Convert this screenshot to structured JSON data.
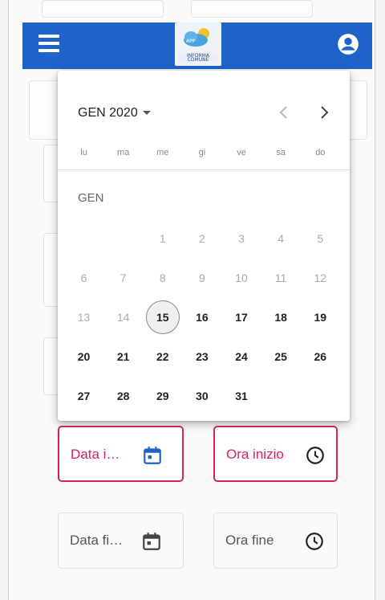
{
  "header": {
    "logo_text": "INFORMA COMUNE",
    "menu_icon": "menu-icon",
    "account_icon": "account-circle-icon",
    "color": "#1e64c8"
  },
  "calendar": {
    "month_year": "GEN 2020",
    "month_label": "GEN",
    "prev_icon": "chevron-left-icon",
    "next_icon": "chevron-right-icon",
    "weekdays": [
      "lu",
      "ma",
      "me",
      "gi",
      "ve",
      "sa",
      "do"
    ],
    "weeks": [
      [
        {
          "day": "",
          "state": "empty"
        },
        {
          "day": "",
          "state": "empty"
        },
        {
          "day": "1",
          "state": "disabled"
        },
        {
          "day": "2",
          "state": "disabled"
        },
        {
          "day": "3",
          "state": "disabled"
        },
        {
          "day": "4",
          "state": "disabled"
        },
        {
          "day": "5",
          "state": "disabled"
        }
      ],
      [
        {
          "day": "6",
          "state": "disabled"
        },
        {
          "day": "7",
          "state": "disabled"
        },
        {
          "day": "8",
          "state": "disabled"
        },
        {
          "day": "9",
          "state": "disabled"
        },
        {
          "day": "10",
          "state": "disabled"
        },
        {
          "day": "11",
          "state": "disabled"
        },
        {
          "day": "12",
          "state": "disabled"
        }
      ],
      [
        {
          "day": "13",
          "state": "disabled"
        },
        {
          "day": "14",
          "state": "disabled"
        },
        {
          "day": "15",
          "state": "today"
        },
        {
          "day": "16",
          "state": "enabled"
        },
        {
          "day": "17",
          "state": "enabled"
        },
        {
          "day": "18",
          "state": "enabled"
        },
        {
          "day": "19",
          "state": "enabled"
        }
      ],
      [
        {
          "day": "20",
          "state": "enabled"
        },
        {
          "day": "21",
          "state": "enabled"
        },
        {
          "day": "22",
          "state": "enabled"
        },
        {
          "day": "23",
          "state": "enabled"
        },
        {
          "day": "24",
          "state": "enabled"
        },
        {
          "day": "25",
          "state": "enabled"
        },
        {
          "day": "26",
          "state": "enabled"
        }
      ],
      [
        {
          "day": "27",
          "state": "enabled"
        },
        {
          "day": "28",
          "state": "enabled"
        },
        {
          "day": "29",
          "state": "enabled"
        },
        {
          "day": "30",
          "state": "enabled"
        },
        {
          "day": "31",
          "state": "enabled"
        },
        {
          "day": "",
          "state": "empty"
        },
        {
          "day": "",
          "state": "empty"
        }
      ]
    ]
  },
  "fields": {
    "start_date": {
      "label": "Data i…",
      "icon": "calendar-icon",
      "state": "focused"
    },
    "start_time": {
      "label": "Ora inizio",
      "icon": "clock-icon",
      "state": "focused"
    },
    "end_date": {
      "label": "Data fi…",
      "icon": "calendar-icon",
      "state": "idle"
    },
    "end_time": {
      "label": "Ora fine",
      "icon": "clock-icon",
      "state": "idle"
    }
  },
  "colors": {
    "accent": "#d02366",
    "primary": "#1e64c8",
    "calendar_icon_active": "#1e64c8",
    "icon_idle": "#444444"
  }
}
